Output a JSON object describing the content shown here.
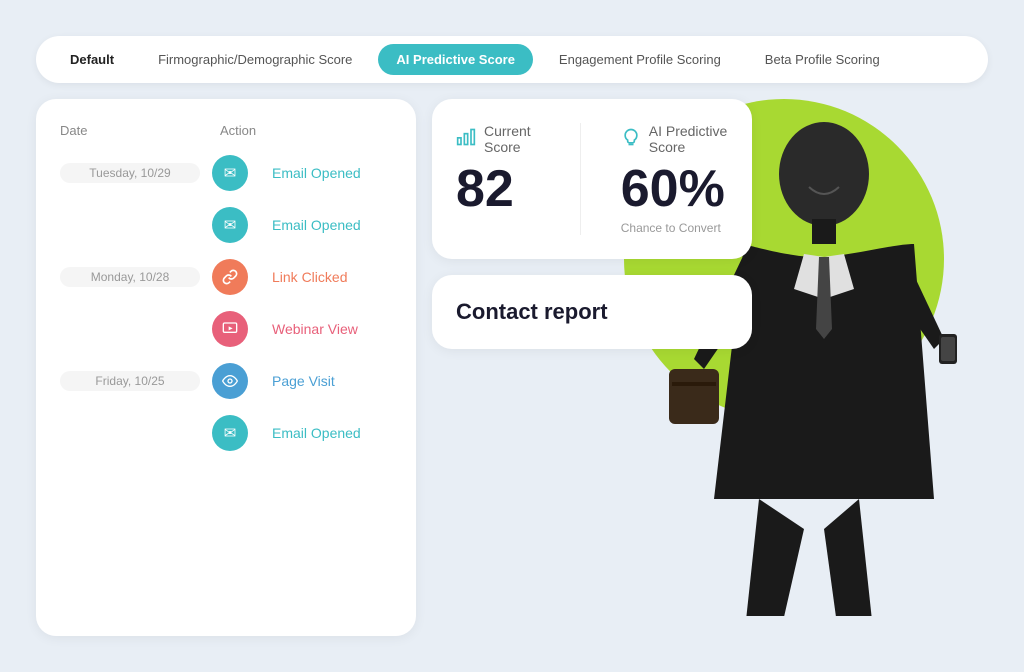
{
  "tabs": [
    {
      "label": "Default",
      "id": "default",
      "active": false,
      "bold": true
    },
    {
      "label": "Firmographic/Demographic Score",
      "id": "firmographic",
      "active": false
    },
    {
      "label": "AI Predictive Score",
      "id": "ai_predictive",
      "active": true
    },
    {
      "label": "Engagement Profile Scoring",
      "id": "engagement",
      "active": false
    },
    {
      "label": "Beta Profile Scoring",
      "id": "beta",
      "active": false
    }
  ],
  "activity": {
    "headers": {
      "date": "Date",
      "action": "Action"
    },
    "rows": [
      {
        "date": "Tuesday, 10/29",
        "icon_type": "email",
        "icon_color": "teal",
        "action": "Email Opened",
        "show_date": true
      },
      {
        "date": "",
        "icon_type": "email",
        "icon_color": "teal",
        "action": "Email Opened",
        "show_date": false
      },
      {
        "date": "Monday, 10/28",
        "icon_type": "link",
        "icon_color": "orange",
        "action": "Link Clicked",
        "show_date": true
      },
      {
        "date": "",
        "icon_type": "webinar",
        "icon_color": "pink",
        "action": "Webinar View",
        "show_date": false
      },
      {
        "date": "Friday, 10/25",
        "icon_type": "eye",
        "icon_color": "blue",
        "action": "Page Visit",
        "show_date": true
      },
      {
        "date": "",
        "icon_type": "email",
        "icon_color": "teal",
        "action": "Email Opened",
        "show_date": false
      }
    ]
  },
  "scores": {
    "current_score": {
      "label": "Current Score",
      "value": "82"
    },
    "predictive_score": {
      "label": "AI Predictive Score",
      "value": "60%",
      "subtext": "Chance to Convert"
    }
  },
  "contact_report": {
    "label": "Contact report"
  },
  "icons": {
    "email": "✉",
    "link": "🔗",
    "webinar": "▶",
    "eye": "👁",
    "bar_chart": "📊",
    "lightbulb": "💡"
  },
  "colors": {
    "teal": "#3bbdc4",
    "orange": "#f07b5a",
    "pink": "#e8607a",
    "blue": "#4a9fd4",
    "green_circle": "#a8d932",
    "active_tab_bg": "#3bbdc4"
  }
}
